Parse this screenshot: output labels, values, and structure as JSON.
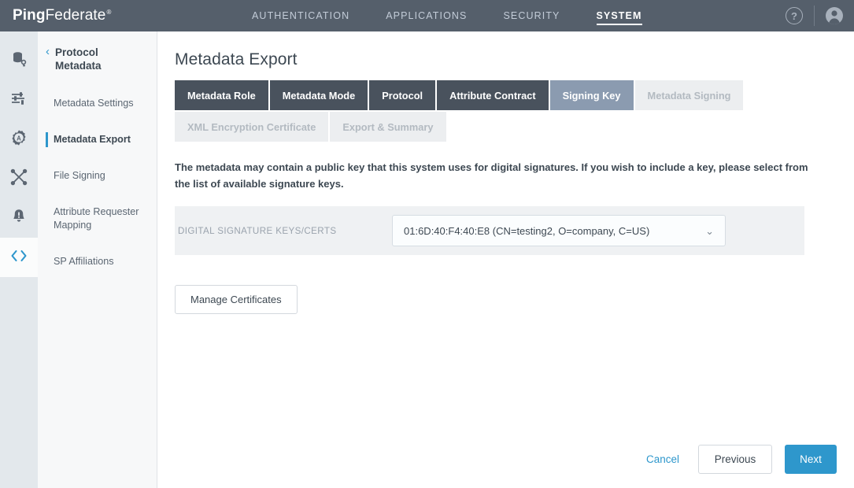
{
  "header": {
    "brand_primary": "Ping",
    "brand_secondary": "Federate",
    "brand_registered": "®",
    "nav": [
      {
        "label": "AUTHENTICATION",
        "active": false
      },
      {
        "label": "APPLICATIONS",
        "active": false
      },
      {
        "label": "SECURITY",
        "active": false
      },
      {
        "label": "SYSTEM",
        "active": true
      }
    ],
    "help_icon": "help-circle-icon",
    "help_glyph": "?",
    "user_icon": "user-avatar-icon",
    "background": "#555f6b"
  },
  "rail": {
    "items": [
      {
        "name": "database-key-icon",
        "active": false
      },
      {
        "name": "sliders-settings-icon",
        "active": false
      },
      {
        "name": "gear-authentication-icon",
        "active": false
      },
      {
        "name": "shuffle-mapping-icon",
        "active": false
      },
      {
        "name": "bell-alert-icon",
        "active": false
      },
      {
        "name": "code-brackets-icon",
        "active": true
      }
    ]
  },
  "sidebar": {
    "back_label": "Protocol Metadata",
    "back_chevron": "‹",
    "items": [
      {
        "label": "Metadata Settings",
        "active": false
      },
      {
        "label": "Metadata Export",
        "active": true
      },
      {
        "label": "File Signing",
        "active": false
      },
      {
        "label": "Attribute Requester Mapping",
        "active": false
      },
      {
        "label": "SP Affiliations",
        "active": false
      }
    ]
  },
  "main": {
    "title": "Metadata Export",
    "tabs": [
      {
        "label": "Metadata Role",
        "state": "done"
      },
      {
        "label": "Metadata Mode",
        "state": "done"
      },
      {
        "label": "Protocol",
        "state": "done"
      },
      {
        "label": "Attribute Contract",
        "state": "done"
      },
      {
        "label": "Signing Key",
        "state": "active"
      },
      {
        "label": "Metadata Signing",
        "state": "disabled"
      },
      {
        "label": "XML Encryption Certificate",
        "state": "disabled"
      },
      {
        "label": "Export & Summary",
        "state": "disabled"
      }
    ],
    "description": "The metadata may contain a public key that this system uses for digital signatures. If you wish to include a key, please select from the list of available signature keys.",
    "form": {
      "label": "DIGITAL SIGNATURE KEYS/CERTS",
      "select_value": "01:6D:40:F4:40:E8 (CN=testing2, O=company, C=US)",
      "select_chevron": "⌄"
    },
    "manage_certificates_label": "Manage Certificates"
  },
  "footer": {
    "cancel_label": "Cancel",
    "previous_label": "Previous",
    "next_label": "Next"
  },
  "colors": {
    "accent_blue": "#2e97cc",
    "header_gray": "#555f6b",
    "tab_done": "#49525d",
    "tab_active": "#8b9bb0",
    "tab_disabled": "#eceef0",
    "form_row_bg": "#eff1f3"
  }
}
